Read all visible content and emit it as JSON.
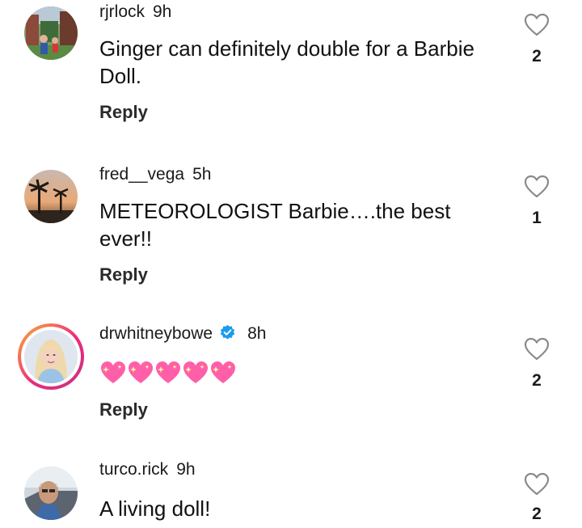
{
  "comments": [
    {
      "username": "rjrlock",
      "time": "9h",
      "text": "Ginger can definitely double for a Barbie Doll.",
      "reply_label": "Reply",
      "likes": "2",
      "verified": false,
      "avatar_icon": "street-photo-avatar"
    },
    {
      "username": "fred__vega",
      "time": "5h",
      "text": "METEOROLOGIST Barbie….the best ever!!",
      "reply_label": "Reply",
      "likes": "1",
      "verified": false,
      "avatar_icon": "palm-tree-sunset-avatar"
    },
    {
      "username": "drwhitneybowe",
      "time": "8h",
      "text": "💖💖💖💖💖",
      "reply_label": "Reply",
      "likes": "2",
      "verified": true,
      "avatar_icon": "portrait-avatar-with-story-ring"
    },
    {
      "username": "turco.rick",
      "time": "9h",
      "text": "A living doll!",
      "reply_label": "",
      "likes": "2",
      "verified": false,
      "avatar_icon": "car-selfie-avatar"
    }
  ],
  "colors": {
    "verified_badge": "#1d9bf0",
    "story_ring_start": "#f9b234",
    "story_ring_end": "#c13584",
    "sparkling_heart": "#ff5fa8"
  }
}
